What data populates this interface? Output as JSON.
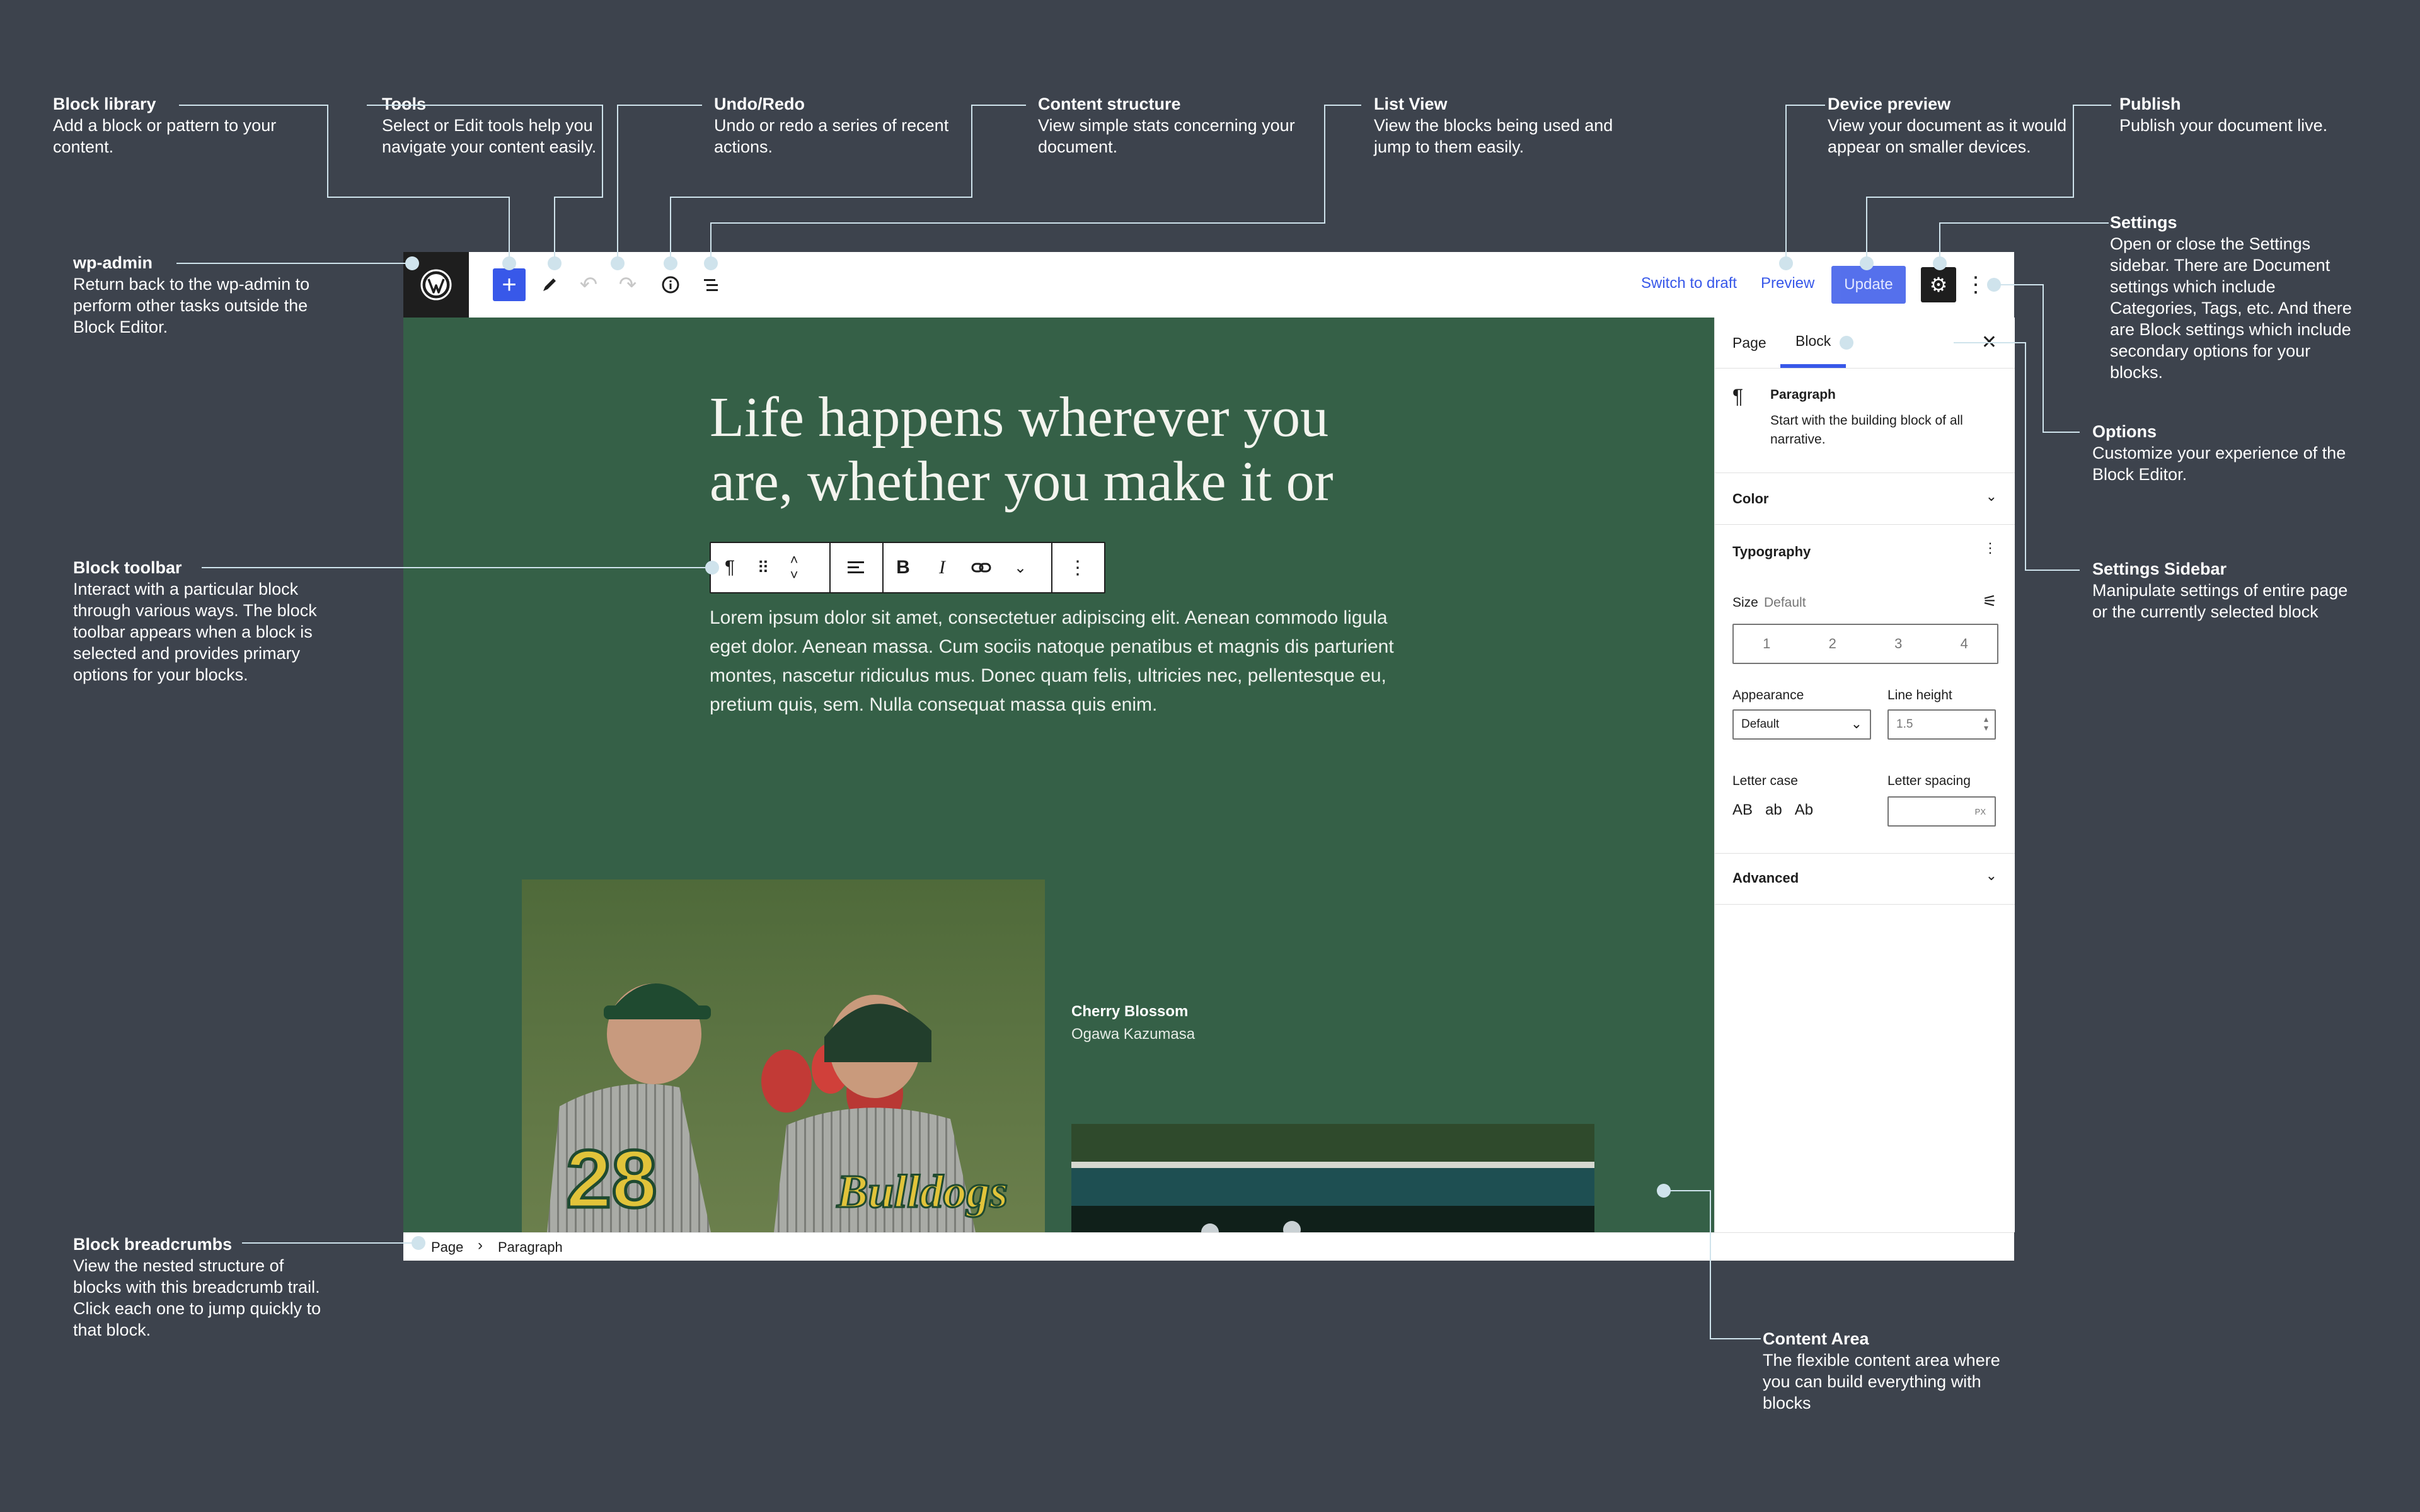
{
  "annotations": {
    "block_library": {
      "title": "Block library",
      "desc": "Add a block or pattern to your content."
    },
    "tools": {
      "title": "Tools",
      "desc": "Select or Edit tools help you navigate your content easily."
    },
    "undo_redo": {
      "title": "Undo/Redo",
      "desc": "Undo or redo a series of recent actions."
    },
    "content_structure": {
      "title": "Content structure",
      "desc": "View simple stats concerning your document."
    },
    "list_view": {
      "title": "List View",
      "desc": "View the blocks being used and jump to them easily."
    },
    "device_preview": {
      "title": "Device preview",
      "desc": "View your document as it would appear on smaller devices."
    },
    "publish": {
      "title": "Publish",
      "desc": "Publish your document live."
    },
    "settings": {
      "title": "Settings",
      "desc": "Open or close the Settings sidebar. There are Document settings which include Categories, Tags, etc. And there are Block settings which include secondary options for your blocks."
    },
    "wp_admin": {
      "title": "wp-admin",
      "desc": "Return back to the wp-admin to perform other tasks outside the Block Editor."
    },
    "options": {
      "title": "Options",
      "desc": "Customize your experience of the Block Editor."
    },
    "settings_sidebar": {
      "title": "Settings Sidebar",
      "desc": "Manipulate settings of entire page or the currently selected block"
    },
    "block_toolbar": {
      "title": "Block toolbar",
      "desc": "Interact with a particular block through various ways. The block toolbar appears when a block is selected and provides primary options for your blocks."
    },
    "block_breadcrumbs": {
      "title": "Block breadcrumbs",
      "desc": "View the nested structure of blocks with this breadcrumb trail. Click each one to jump quickly to that block."
    },
    "content_area": {
      "title": "Content Area",
      "desc": "The flexible content area where you can build everything with blocks"
    }
  },
  "topbar": {
    "switch_to_draft": "Switch to draft",
    "preview": "Preview",
    "update": "Update"
  },
  "content": {
    "heading": "Life happens wherever you are, whether you make it or not.",
    "paragraph": "Lorem ipsum dolor sit amet, consectetuer adipiscing elit. Aenean commodo ligula eget dolor. Aenean massa. Cum sociis natoque penatibus et magnis dis parturient montes, nascetur ridiculus mus. Donec quam felis, ultricies nec, pellentesque eu, pretium quis, sem. Nulla consequat massa quis enim.",
    "caption_title": "Cherry Blossom",
    "caption_subtitle": "Ogawa Kazumasa",
    "jersey_number": "28",
    "jersey_text": "Bulldogs"
  },
  "sidebar": {
    "tabs": [
      "Page",
      "Block"
    ],
    "active_tab": "Block",
    "block_name": "Paragraph",
    "block_desc": "Start with the building block of all narrative.",
    "sections": {
      "color": "Color",
      "typography": "Typography",
      "advanced": "Advanced"
    },
    "size_label": "Size",
    "size_value": "Default",
    "size_options": [
      "1",
      "2",
      "3",
      "4"
    ],
    "appearance_label": "Appearance",
    "appearance_value": "Default",
    "line_height_label": "Line height",
    "line_height_value": "1.5",
    "letter_case_label": "Letter case",
    "letter_case_options": [
      "AB",
      "ab",
      "Ab"
    ],
    "letter_spacing_label": "Letter spacing",
    "letter_spacing_unit": "PX"
  },
  "breadcrumb": [
    "Page",
    "Paragraph"
  ],
  "colors": {
    "background": "#3d434d",
    "canvas": "#356047",
    "accent": "#3858e9",
    "annotation_dot": "#cfe3ec"
  }
}
